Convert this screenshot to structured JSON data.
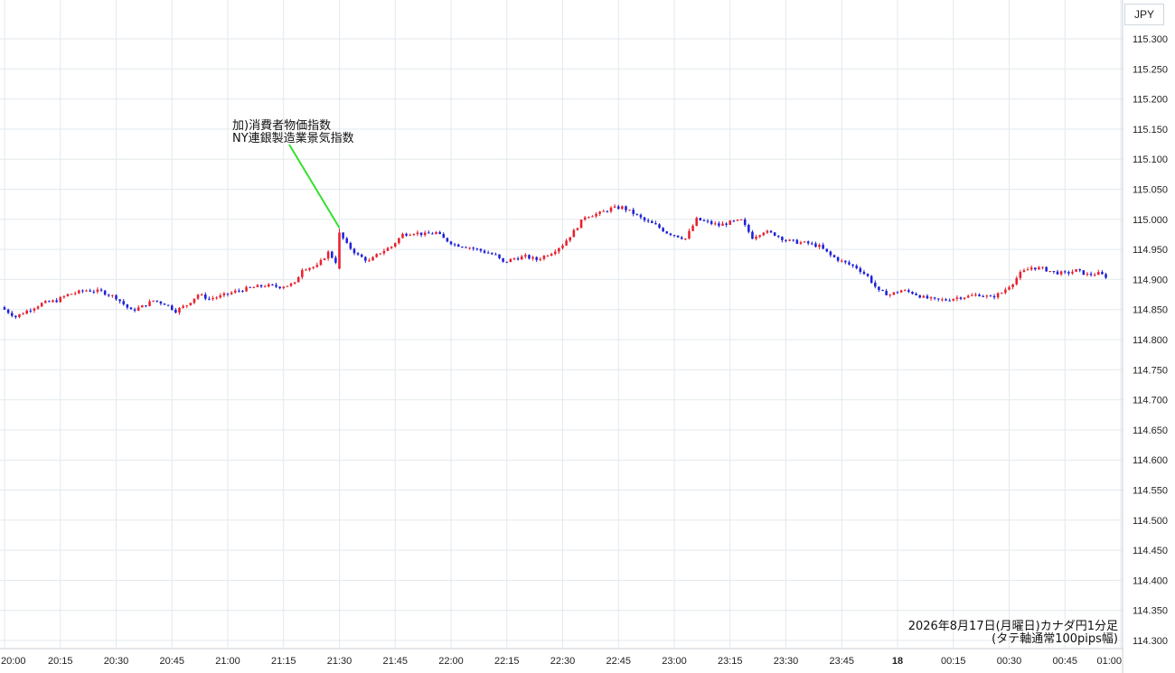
{
  "currency_label": "JPY",
  "caption": {
    "line1": "2026年8月17日(月曜日)カナダ円1分足",
    "line2": "(タテ軸通常100pips幅)"
  },
  "annotation": {
    "line1": "加)消費者物価指数",
    "line2": "NY連銀製造業景気指数"
  },
  "colors": {
    "up": "#e8212d",
    "down": "#1f22d6",
    "grid": "#e3e9ee",
    "annotation_line": "#34e02e"
  },
  "chart_data": {
    "type": "candlestick",
    "timeframe": "1m",
    "y_axis": {
      "min": 114.3,
      "max": 115.3,
      "ticks": [
        "115.300",
        "115.250",
        "115.200",
        "115.150",
        "115.100",
        "115.050",
        "115.000",
        "114.950",
        "114.900",
        "114.850",
        "114.800",
        "114.750",
        "114.700",
        "114.650",
        "114.600",
        "114.550",
        "114.500",
        "114.450",
        "114.400",
        "114.350",
        "114.300"
      ]
    },
    "x_axis": {
      "start_minute": 0,
      "end_minute": 300,
      "ticks": [
        {
          "minute": 0,
          "label": "20:00"
        },
        {
          "minute": 15,
          "label": "20:15"
        },
        {
          "minute": 30,
          "label": "20:30"
        },
        {
          "minute": 45,
          "label": "20:45"
        },
        {
          "minute": 60,
          "label": "21:00"
        },
        {
          "minute": 75,
          "label": "21:15"
        },
        {
          "minute": 90,
          "label": "21:30"
        },
        {
          "minute": 105,
          "label": "21:45"
        },
        {
          "minute": 120,
          "label": "22:00"
        },
        {
          "minute": 135,
          "label": "22:15"
        },
        {
          "minute": 150,
          "label": "22:30"
        },
        {
          "minute": 165,
          "label": "22:45"
        },
        {
          "minute": 180,
          "label": "23:00"
        },
        {
          "minute": 195,
          "label": "23:15"
        },
        {
          "minute": 210,
          "label": "23:30"
        },
        {
          "minute": 225,
          "label": "23:45"
        },
        {
          "minute": 240,
          "label": "18"
        },
        {
          "minute": 255,
          "label": "00:15"
        },
        {
          "minute": 270,
          "label": "00:30"
        },
        {
          "minute": 285,
          "label": "00:45"
        },
        {
          "minute": 300,
          "label": "01:00"
        }
      ]
    },
    "event_minute": 90,
    "close_path": [
      [
        0,
        114.85
      ],
      [
        3,
        114.838
      ],
      [
        6,
        114.848
      ],
      [
        10,
        114.86
      ],
      [
        14,
        114.865
      ],
      [
        17,
        114.875
      ],
      [
        22,
        114.882
      ],
      [
        26,
        114.88
      ],
      [
        30,
        114.87
      ],
      [
        34,
        114.848
      ],
      [
        37,
        114.855
      ],
      [
        40,
        114.865
      ],
      [
        43,
        114.86
      ],
      [
        46,
        114.848
      ],
      [
        49,
        114.858
      ],
      [
        52,
        114.875
      ],
      [
        55,
        114.868
      ],
      [
        58,
        114.872
      ],
      [
        62,
        114.88
      ],
      [
        66,
        114.886
      ],
      [
        70,
        114.89
      ],
      [
        74,
        114.888
      ],
      [
        78,
        114.893
      ],
      [
        80,
        114.918
      ],
      [
        84,
        114.922
      ],
      [
        87,
        114.945
      ],
      [
        89,
        114.93
      ],
      [
        90,
        114.978
      ],
      [
        92,
        114.958
      ],
      [
        95,
        114.94
      ],
      [
        98,
        114.93
      ],
      [
        101,
        114.945
      ],
      [
        104,
        114.955
      ],
      [
        107,
        114.975
      ],
      [
        110,
        114.978
      ],
      [
        113,
        114.975
      ],
      [
        116,
        114.978
      ],
      [
        118,
        114.968
      ],
      [
        121,
        114.958
      ],
      [
        124,
        114.955
      ],
      [
        128,
        114.948
      ],
      [
        132,
        114.94
      ],
      [
        134,
        114.928
      ],
      [
        137,
        114.935
      ],
      [
        140,
        114.938
      ],
      [
        143,
        114.933
      ],
      [
        147,
        114.945
      ],
      [
        150,
        114.958
      ],
      [
        153,
        114.98
      ],
      [
        156,
        115.005
      ],
      [
        160,
        115.01
      ],
      [
        163,
        115.018
      ],
      [
        166,
        115.02
      ],
      [
        169,
        115.01
      ],
      [
        172,
        114.998
      ],
      [
        175,
        114.99
      ],
      [
        178,
        114.978
      ],
      [
        181,
        114.972
      ],
      [
        183,
        114.968
      ],
      [
        186,
        115.0
      ],
      [
        189,
        114.995
      ],
      [
        192,
        114.99
      ],
      [
        195,
        114.995
      ],
      [
        198,
        114.998
      ],
      [
        201,
        114.97
      ],
      [
        204,
        114.98
      ],
      [
        207,
        114.975
      ],
      [
        210,
        114.965
      ],
      [
        213,
        114.962
      ],
      [
        216,
        114.96
      ],
      [
        219,
        114.955
      ],
      [
        222,
        114.94
      ],
      [
        225,
        114.93
      ],
      [
        229,
        114.92
      ],
      [
        232,
        114.905
      ],
      [
        235,
        114.88
      ],
      [
        238,
        114.875
      ],
      [
        241,
        114.882
      ],
      [
        244,
        114.878
      ],
      [
        247,
        114.87
      ],
      [
        250,
        114.866
      ],
      [
        253,
        114.866
      ],
      [
        256,
        114.87
      ],
      [
        259,
        114.872
      ],
      [
        262,
        114.875
      ],
      [
        265,
        114.87
      ],
      [
        268,
        114.878
      ],
      [
        271,
        114.895
      ],
      [
        273,
        114.91
      ],
      [
        276,
        114.92
      ],
      [
        279,
        114.918
      ],
      [
        282,
        114.912
      ],
      [
        285,
        114.91
      ],
      [
        288,
        114.915
      ],
      [
        291,
        114.908
      ],
      [
        294,
        114.91
      ],
      [
        296,
        114.905
      ]
    ]
  }
}
